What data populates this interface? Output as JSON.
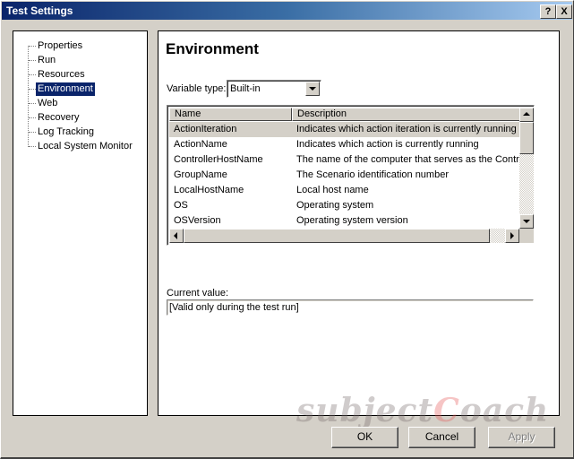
{
  "window": {
    "title": "Test Settings",
    "help_button": "?",
    "close_button": "X"
  },
  "tree": {
    "items": [
      {
        "label": "Properties",
        "selected": false
      },
      {
        "label": "Run",
        "selected": false
      },
      {
        "label": "Resources",
        "selected": false
      },
      {
        "label": "Environment",
        "selected": true
      },
      {
        "label": "Web",
        "selected": false
      },
      {
        "label": "Recovery",
        "selected": false
      },
      {
        "label": "Log Tracking",
        "selected": false
      },
      {
        "label": "Local System Monitor",
        "selected": false
      }
    ]
  },
  "panel": {
    "heading": "Environment",
    "variable_type_label": "Variable type:",
    "variable_type_value": "Built-in",
    "table": {
      "columns": [
        "Name",
        "Description"
      ],
      "rows": [
        {
          "name": "ActionIteration",
          "description": "Indicates which action iteration is currently running",
          "selected": true
        },
        {
          "name": "ActionName",
          "description": "Indicates which action is currently running",
          "selected": false
        },
        {
          "name": "ControllerHostName",
          "description": "The name of the computer that serves as the Controller",
          "selected": false
        },
        {
          "name": "GroupName",
          "description": "The Scenario identification number",
          "selected": false
        },
        {
          "name": "LocalHostName",
          "description": "Local host name",
          "selected": false
        },
        {
          "name": "OS",
          "description": "Operating system",
          "selected": false
        },
        {
          "name": "OSVersion",
          "description": "Operating system version",
          "selected": false
        }
      ]
    },
    "current_value_label": "Current value:",
    "current_value": "[Valid only during the test run]"
  },
  "watermark": {
    "prefix": "subject",
    "c": "C",
    "suffix": "oach"
  },
  "buttons": {
    "ok": "OK",
    "cancel": "Cancel",
    "apply": "Apply"
  }
}
